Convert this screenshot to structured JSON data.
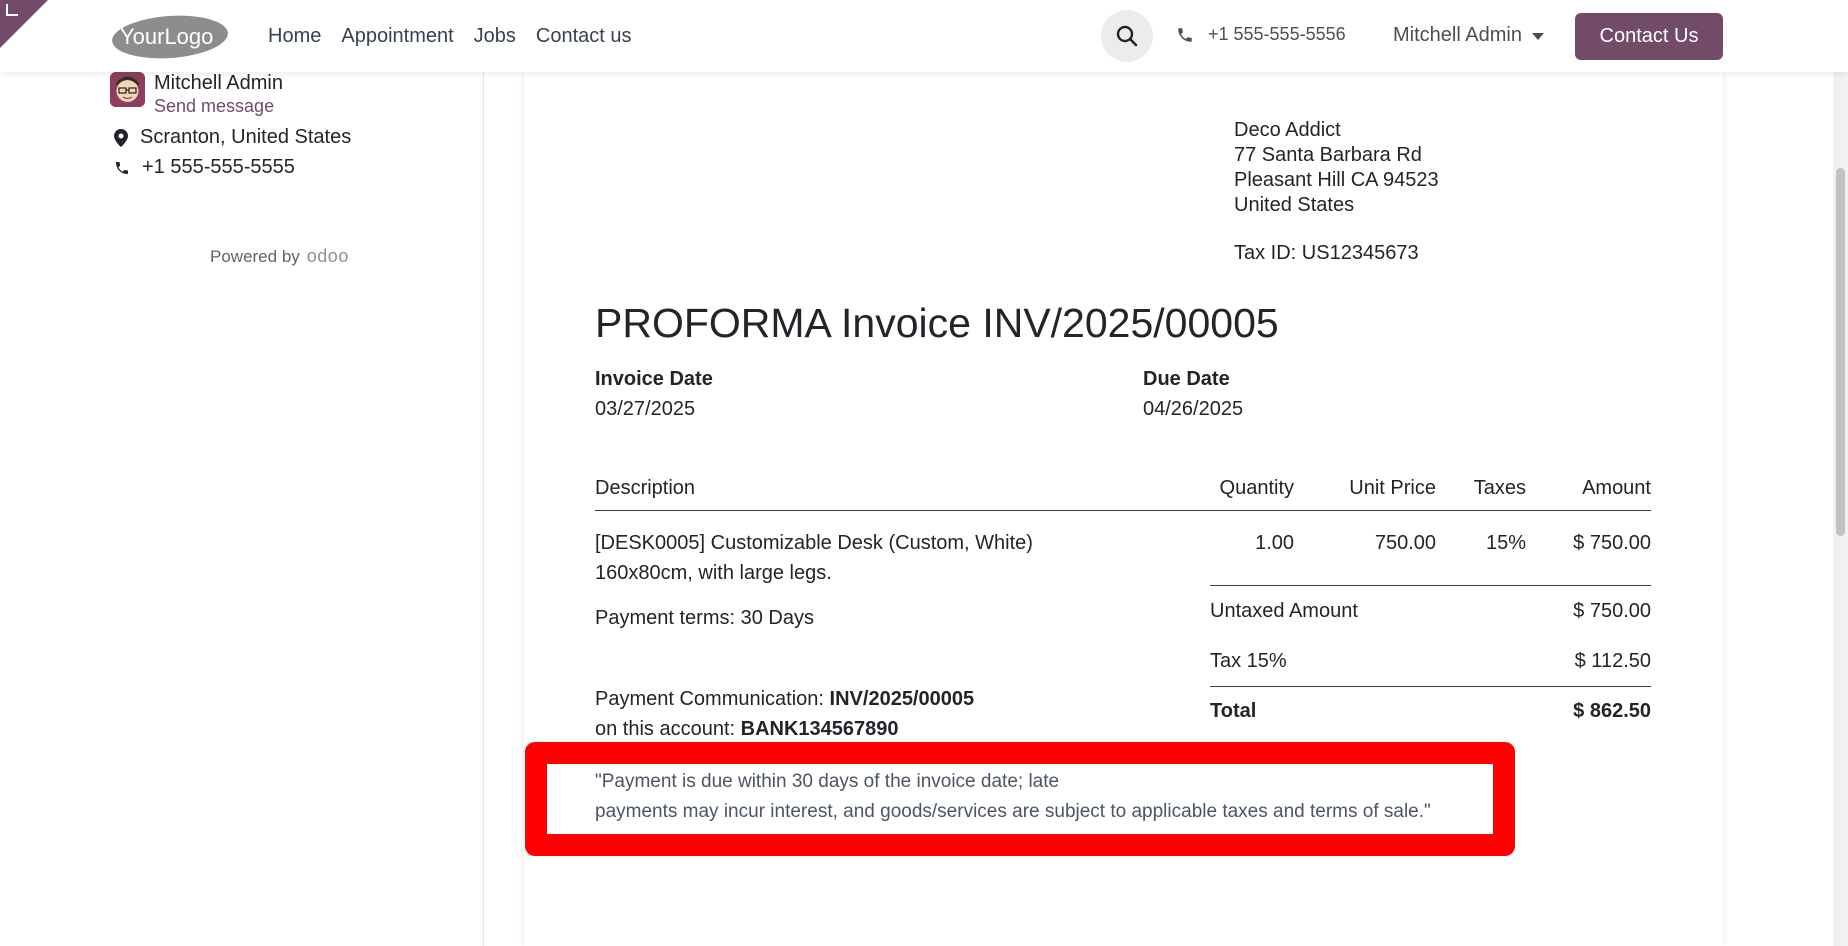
{
  "header": {
    "logo_text": "YourLogo",
    "nav": [
      "Home",
      "Appointment",
      "Jobs",
      "Contact us"
    ],
    "phone": "+1 555-555-5556",
    "user": "Mitchell Admin",
    "contact_button": "Contact Us"
  },
  "sidebar": {
    "name": "Mitchell Admin",
    "send_message": "Send message",
    "location": "Scranton, United States",
    "phone": "+1 555-555-5555",
    "powered_by": "Powered by",
    "powered_brand": "odoo"
  },
  "invoice": {
    "customer": {
      "name": "Deco Addict",
      "street": "77 Santa Barbara Rd",
      "city": "Pleasant Hill CA 94523",
      "country": "United States",
      "tax_id": "Tax ID: US12345673"
    },
    "title": "PROFORMA Invoice INV/2025/00005",
    "invoice_date_label": "Invoice Date",
    "invoice_date": "03/27/2025",
    "due_date_label": "Due Date",
    "due_date": "04/26/2025",
    "columns": [
      "Description",
      "Quantity",
      "Unit Price",
      "Taxes",
      "Amount"
    ],
    "lines": [
      {
        "description_1": "[DESK0005] Customizable Desk (Custom, White)",
        "description_2": "160x80cm, with large legs.",
        "quantity": "1.00",
        "unit_price": "750.00",
        "taxes": "15%",
        "amount": "$ 750.00"
      }
    ],
    "payment_terms": "Payment terms: 30 Days",
    "untaxed_label": "Untaxed Amount",
    "untaxed_value": "$ 750.00",
    "tax_label": "Tax 15%",
    "tax_value": "$ 112.50",
    "total_label": "Total",
    "total_value": "$ 862.50",
    "payment_comm_label": "Payment Communication:",
    "payment_comm_value": "INV/2025/00005",
    "account_label": "on this account:",
    "account_value": "BANK134567890",
    "note_line1": "\"Payment is due within 30 days of the invoice date; late",
    "note_line2": "payments may incur interest, and goods/services are subject to applicable taxes and terms of sale.\""
  },
  "colors": {
    "brand": "#714B67",
    "highlight": "#ff0000"
  }
}
